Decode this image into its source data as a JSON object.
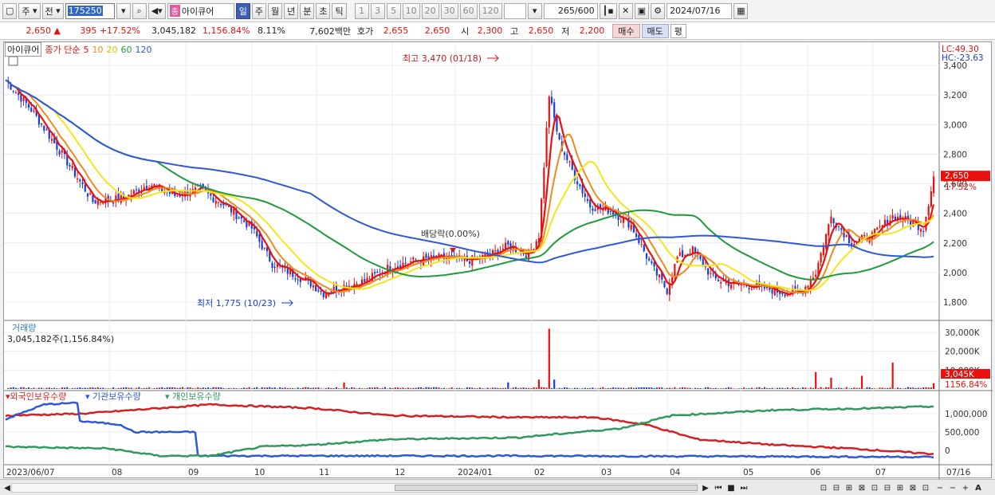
{
  "toolbar": {
    "market": "주",
    "prev": "전",
    "code": "175250",
    "stock_badge": "종",
    "stock_name": "아이큐어",
    "periods": [
      "일",
      "주",
      "월",
      "년",
      "분",
      "초",
      "틱"
    ],
    "intervals": [
      "1",
      "3",
      "5",
      "10",
      "20",
      "30",
      "60",
      "120"
    ],
    "count": "265",
    "count_total": "/600",
    "date": "2024/07/16"
  },
  "quote": {
    "price": "2,650 ▲",
    "change": "395 +17.52%",
    "volume": "3,045,182",
    "volume_pct": "1,156.84%",
    "turnover": "8.11%",
    "amount": "7,602백만",
    "ask_label": "호가",
    "ask": "2,655",
    "bid": "2,650",
    "open_label": "시",
    "open": "2,300",
    "high_label": "고",
    "high": "2,650",
    "low_label": "저",
    "low": "2,200",
    "buy": "매수",
    "sell": "매도",
    "avg": "평"
  },
  "legend": {
    "name": "아이큐어",
    "title": "종가 단순",
    "ma": [
      {
        "label": "5",
        "color": "#e8110f"
      },
      {
        "label": "10",
        "color": "#f08a1c"
      },
      {
        "label": "20",
        "color": "#f5e61a"
      },
      {
        "label": "60",
        "color": "#219a3c"
      },
      {
        "label": "120",
        "color": "#2f58d6"
      }
    ]
  },
  "price_panel": {
    "lc": "LC:49.30",
    "hc": "HC:-23.63",
    "y_ticks": [
      "3,400",
      "3,200",
      "3,000",
      "2,800",
      "2,600",
      "2,400",
      "2,200",
      "2,000",
      "1,800"
    ],
    "y_values": [
      3400,
      3200,
      3000,
      2800,
      2600,
      2400,
      2200,
      2000,
      1800
    ],
    "current_price": "2,650",
    "current_pct": "17.52%",
    "high_annot": "최고 3,470 (01/18)",
    "low_annot": "최저 1,775 (10/23)",
    "dividend_annot": "배당락(0.00%)"
  },
  "volume_panel": {
    "title": "거래량",
    "value": "3,045,182주(1,156.84%)",
    "y_ticks": [
      "30,000K",
      "20,000K",
      "10,000K"
    ],
    "current": "3,045K",
    "current_pct": "1156.84%"
  },
  "holding_panel": {
    "series": [
      {
        "label": "외국인보유수량",
        "color": "#d42020"
      },
      {
        "label": "기관보유수량",
        "color": "#2f58d6"
      },
      {
        "label": "개인보유수량",
        "color": "#2f9a5c"
      }
    ],
    "y_ticks": [
      "1,000,000",
      "500,000",
      "0"
    ]
  },
  "x_axis": [
    "2023/06/07",
    "08",
    "09",
    "10",
    "11",
    "12",
    "2024/01",
    "02",
    "03",
    "04",
    "05",
    "06",
    "07",
    "07/16"
  ],
  "colors": {
    "up": "#e8110f",
    "down": "#1a3fd6"
  }
}
